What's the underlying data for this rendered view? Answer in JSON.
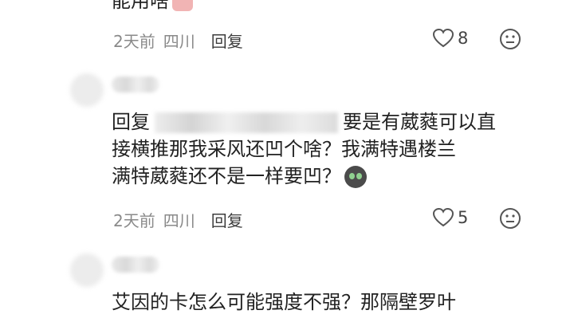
{
  "comments": [
    {
      "text_tail": "能用啥",
      "meta": {
        "time": "2天前",
        "location": "四川",
        "reply": "回复"
      },
      "likes": "8"
    },
    {
      "reply_prefix": "回复",
      "line1": "要是有葳蕤可以直",
      "line2": "接横推那我采风还凹个啥？我满特遇楼兰",
      "line3": "满特葳蕤还不是一样要凹？",
      "meta": {
        "time": "2天前",
        "location": "四川",
        "reply": "回复"
      },
      "likes": "5"
    },
    {
      "line1": "艾因的卡怎么可能强度不强？那隔壁罗叶"
    }
  ]
}
